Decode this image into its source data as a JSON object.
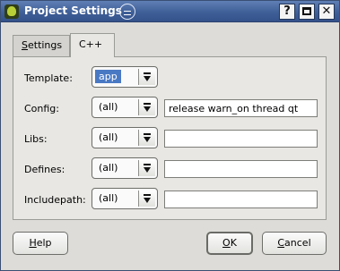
{
  "window": {
    "title": "Project Settings",
    "controls": {
      "help": "?",
      "close": "✕"
    }
  },
  "tabs": [
    {
      "label": "Settings",
      "mnemonic": "S",
      "rest": "ettings",
      "active": false
    },
    {
      "label": "C++",
      "active": true
    }
  ],
  "fields": [
    {
      "label": "Template:",
      "combo_value": "app",
      "combo_selected": true,
      "text_value": null
    },
    {
      "label": "Config:",
      "combo_value": "(all)",
      "text_value": "release warn_on thread qt"
    },
    {
      "label": "Libs:",
      "combo_value": "(all)",
      "text_value": ""
    },
    {
      "label": "Defines:",
      "combo_value": "(all)",
      "text_value": ""
    },
    {
      "label": "Includepath:",
      "combo_value": "(all)",
      "text_value": ""
    }
  ],
  "buttons": {
    "help": {
      "label": "Help",
      "mnemonic": "H",
      "rest": "elp"
    },
    "ok": {
      "label": "OK",
      "mnemonic": "O",
      "rest": "K"
    },
    "cancel": {
      "label": "Cancel",
      "mnemonic": "C",
      "rest": "ancel"
    }
  },
  "colors": {
    "titlebar": "#3f5f98",
    "selection": "#4a79c4",
    "dialog_bg": "#dddcd8",
    "panel_bg": "#e8e7e3"
  }
}
